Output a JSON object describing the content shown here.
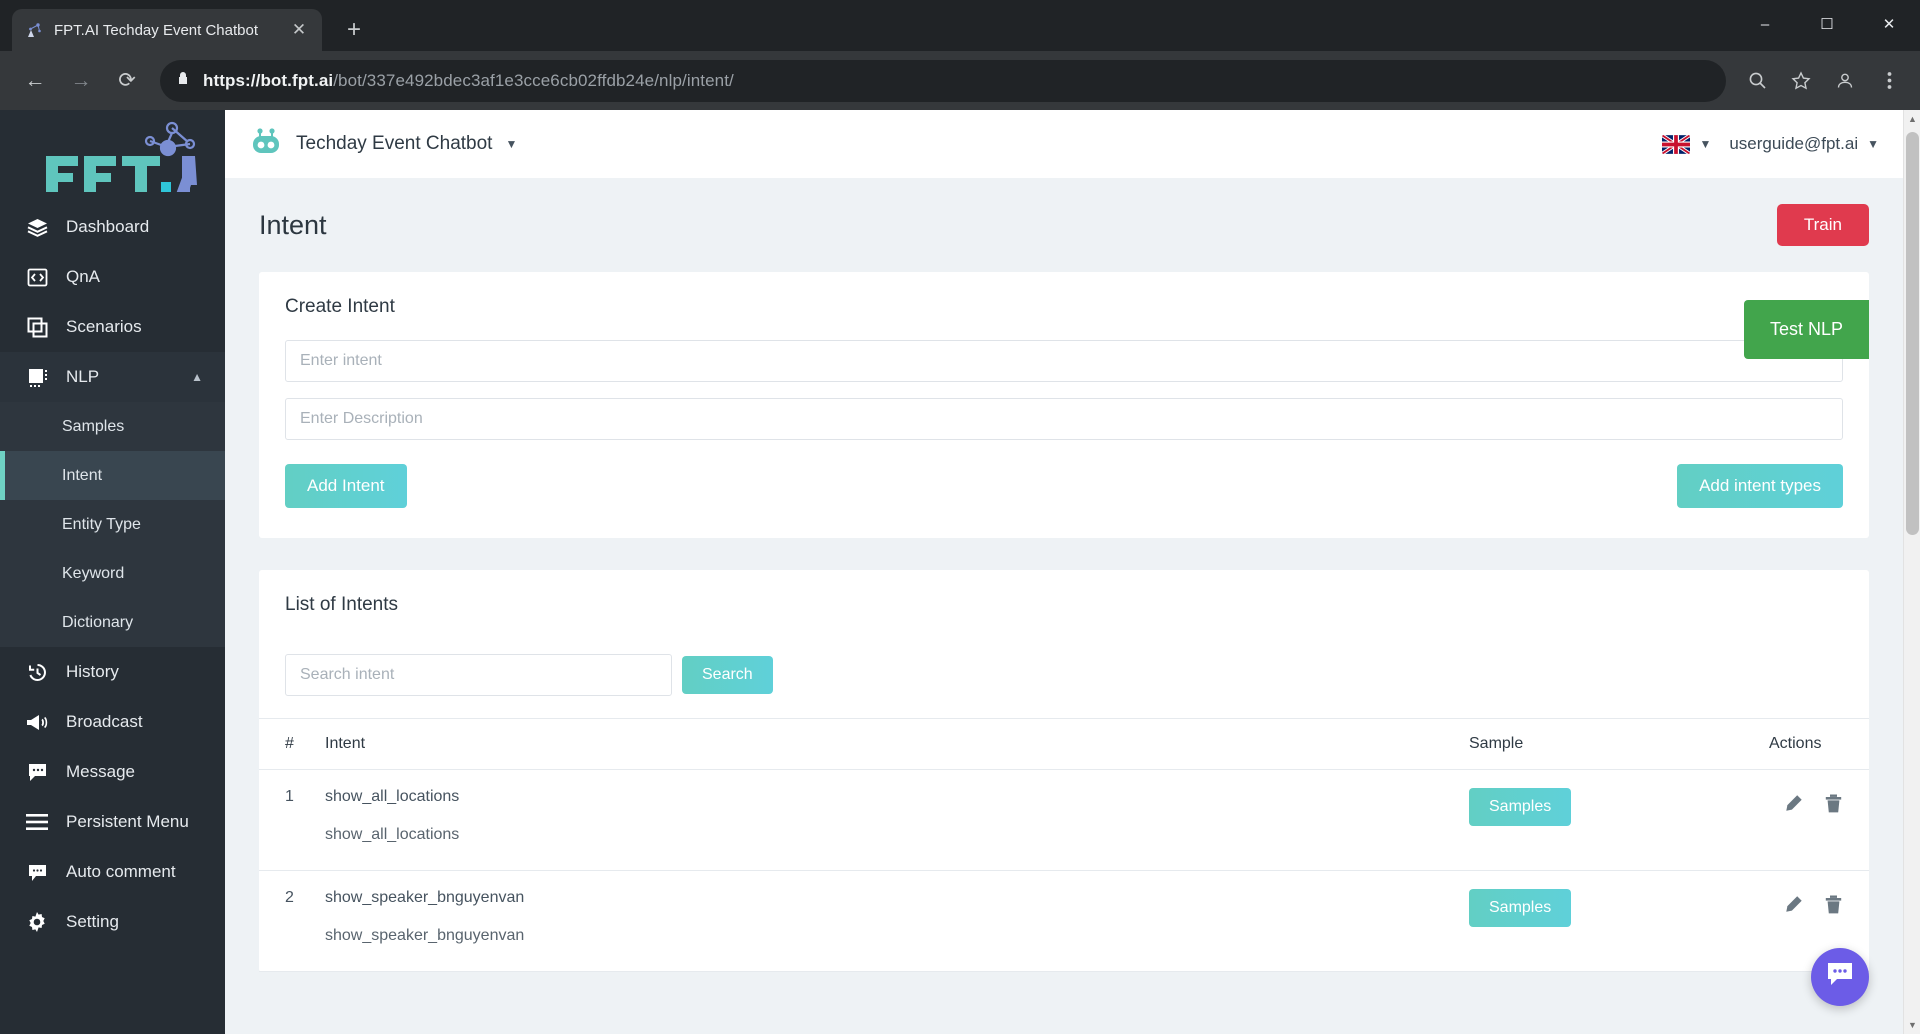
{
  "browser": {
    "tab": {
      "title": "FPT.AI Techday Event Chatbot",
      "favicon_icon": "fpt-ai-favicon",
      "close_icon": "close-icon"
    },
    "new_tab_icon": "plus-icon",
    "window": {
      "minimize": "minimize-icon",
      "maximize": "maximize-icon",
      "close": "window-close-icon"
    },
    "nav": {
      "back_icon": "back-arrow-icon",
      "forward_icon": "forward-arrow-icon",
      "reload_icon": "reload-icon"
    },
    "url": {
      "lock_icon": "lock-icon",
      "scheme_host": "https://bot.fpt.ai",
      "path": "/bot/337e492bdec3af1e3cce6cb02ffdb24e/nlp/intent/"
    },
    "omni_icons": [
      "zoom-search-icon",
      "bookmark-star-icon",
      "profile-people-icon",
      "more-menu-icon"
    ]
  },
  "sidebar": {
    "logo": "FPT.AI",
    "items": [
      {
        "label": "Dashboard",
        "icon": "layers-icon"
      },
      {
        "label": "QnA",
        "icon": "code-brackets-icon"
      },
      {
        "label": "Scenarios",
        "icon": "copy-windows-icon"
      },
      {
        "label": "NLP",
        "icon": "chip-icon",
        "chevron": "chevron-up-icon",
        "expanded": true
      }
    ],
    "nlp_children": [
      {
        "label": "Samples",
        "active": false
      },
      {
        "label": "Intent",
        "active": true
      },
      {
        "label": "Entity Type",
        "active": false
      },
      {
        "label": "Keyword",
        "active": false
      },
      {
        "label": "Dictionary",
        "active": false
      }
    ],
    "items_bottom": [
      {
        "label": "History",
        "icon": "history-clock-icon"
      },
      {
        "label": "Broadcast",
        "icon": "megaphone-icon"
      },
      {
        "label": "Message",
        "icon": "message-bubble-icon"
      },
      {
        "label": "Persistent Menu",
        "icon": "hamburger-lines-icon"
      },
      {
        "label": "Auto comment",
        "icon": "comment-bubble-icon"
      },
      {
        "label": "Setting",
        "icon": "gear-icon"
      }
    ],
    "active_accent": "#6fd2c4"
  },
  "topbar": {
    "bot_icon": "robot-icon",
    "bot_name": "Techday Event Chatbot",
    "bot_caret": "chevron-down-icon",
    "language_flag": "uk-flag-icon",
    "language_caret": "chevron-down-icon",
    "user_email": "userguide@fpt.ai",
    "user_caret": "chevron-down-icon"
  },
  "page": {
    "title": "Intent",
    "train_label": "Train",
    "train_color": "#e03a4e",
    "test_nlp_label": "Test NLP",
    "test_nlp_color": "#42a54c"
  },
  "create_intent": {
    "title": "Create Intent",
    "intent_placeholder": "Enter intent",
    "intent_value": "",
    "description_placeholder": "Enter Description",
    "description_value": "",
    "add_intent_label": "Add Intent",
    "add_intent_types_label": "Add intent types",
    "accent": "#62cfc4"
  },
  "list_of_intents": {
    "title": "List of Intents",
    "search_placeholder": "Search intent",
    "search_value": "",
    "search_button_label": "Search",
    "columns": [
      "#",
      "Intent",
      "Sample",
      "Actions"
    ],
    "rows": [
      {
        "num": "1",
        "intent": "show_all_locations",
        "description": "show_all_locations",
        "sample_label": "Samples",
        "edit_icon": "pencil-icon",
        "delete_icon": "trash-icon"
      },
      {
        "num": "2",
        "intent": "show_speaker_bnguyenvan",
        "description": "show_speaker_bnguyenvan",
        "sample_label": "Samples",
        "edit_icon": "pencil-icon",
        "delete_icon": "trash-icon"
      }
    ]
  },
  "chat_widget": {
    "icon": "chat-dots-icon",
    "color": "#6c5ce7"
  }
}
